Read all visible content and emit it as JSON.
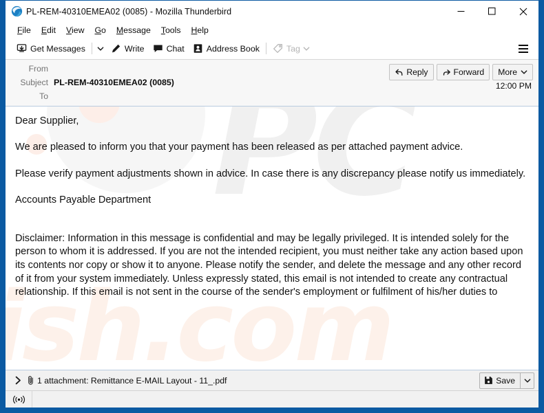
{
  "window": {
    "title": "PL-REM-40310EMEA02 (0085) - Mozilla Thunderbird",
    "app_icon": "thunderbird-icon",
    "frame_color": "#0b5aa2",
    "controls": {
      "minimize": "minimize-icon",
      "maximize": "maximize-icon",
      "close": "close-icon"
    }
  },
  "menubar": {
    "items": [
      {
        "label": "File",
        "accesskey": "F"
      },
      {
        "label": "Edit",
        "accesskey": "E"
      },
      {
        "label": "View",
        "accesskey": "V"
      },
      {
        "label": "Go",
        "accesskey": "G"
      },
      {
        "label": "Message",
        "accesskey": "M"
      },
      {
        "label": "Tools",
        "accesskey": "T"
      },
      {
        "label": "Help",
        "accesskey": "H"
      }
    ]
  },
  "toolbar": {
    "get_messages_label": "Get Messages",
    "get_messages_icon": "download-inbox-icon",
    "get_messages_dropdown_icon": "chevron-down-icon",
    "write_label": "Write",
    "write_icon": "pencil-icon",
    "chat_label": "Chat",
    "chat_icon": "chat-bubble-icon",
    "address_book_label": "Address Book",
    "address_book_icon": "address-book-icon",
    "tag_label": "Tag",
    "tag_icon": "tag-icon",
    "tag_dropdown_icon": "chevron-down-icon",
    "tag_disabled": true,
    "app_menu_icon": "hamburger-icon"
  },
  "message_header": {
    "from_label": "From",
    "from_value": "",
    "subject_label": "Subject",
    "subject_value": "PL-REM-40310EMEA02 (0085)",
    "to_label": "To",
    "to_value": "",
    "timestamp": "12:00 PM",
    "actions": {
      "reply_label": "Reply",
      "reply_icon": "reply-arrow-icon",
      "forward_label": "Forward",
      "forward_icon": "forward-arrow-icon",
      "more_label": "More",
      "more_icon": "chevron-down-icon"
    }
  },
  "message_body": {
    "greeting": "Dear Supplier,",
    "paragraph_1": "We are pleased to inform you that your payment has been released as per attached payment advice.",
    "paragraph_2": "Please verify payment adjustments shown in advice. In case there is any discrepancy please notify us immediately.",
    "signature": "Accounts Payable Department",
    "disclaimer": "Disclaimer: Information in this message is confidential and may be legally privileged. It is intended solely for the person to whom it is addressed. If you are not the intended recipient, you must neither take any action based upon its contents nor copy or show it to anyone. Please notify the sender, and delete the message and any other record of it from your system immediately. Unless expressly stated, this email is not intended to create any contractual relationship. If this email is not sent in the course of the sender's employment or fulfilment of his/her duties to",
    "watermark_top": "PC",
    "watermark_bottom": "ish.com"
  },
  "attachment_bar": {
    "expand_icon": "chevron-right-icon",
    "paperclip_icon": "paperclip-icon",
    "label": "1 attachment: Remittance E-MAIL Layout - 11_.pdf",
    "save_label": "Save",
    "save_icon": "floppy-disk-icon",
    "save_dropdown_icon": "chevron-down-icon"
  },
  "status_bar": {
    "connection_icon": "broadcast-online-icon",
    "text": ""
  }
}
